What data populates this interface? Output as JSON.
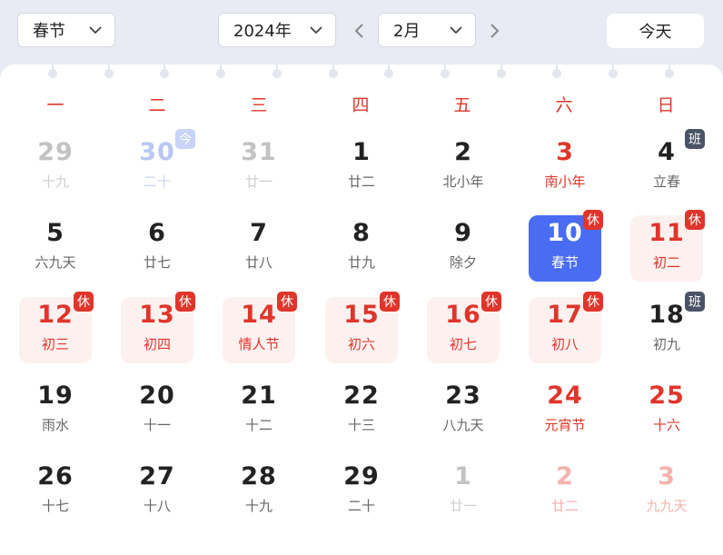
{
  "toolbar": {
    "festival_value": "春节",
    "year_value": "2024年",
    "month_value": "2月",
    "today_label": "今天"
  },
  "weekdays": [
    "一",
    "二",
    "三",
    "四",
    "五",
    "六",
    "日"
  ],
  "colors": {
    "accent_red": "#e0352b",
    "selected_blue": "#4a6cf2",
    "holiday_bg": "#fdf1f0",
    "workday_badge": "#4b5466"
  },
  "days": [
    {
      "num": "29",
      "sub": "十九",
      "type": "other"
    },
    {
      "num": "30",
      "sub": "二十",
      "type": "today-prev",
      "badge": "今"
    },
    {
      "num": "31",
      "sub": "廿一",
      "type": "other"
    },
    {
      "num": "1",
      "sub": "廿二",
      "type": "normal"
    },
    {
      "num": "2",
      "sub": "北小年",
      "type": "normal"
    },
    {
      "num": "3",
      "sub": "南小年",
      "type": "red"
    },
    {
      "num": "4",
      "sub": "立春",
      "type": "normal",
      "badge": "班"
    },
    {
      "num": "5",
      "sub": "六九天",
      "type": "normal"
    },
    {
      "num": "6",
      "sub": "廿七",
      "type": "normal"
    },
    {
      "num": "7",
      "sub": "廿八",
      "type": "normal"
    },
    {
      "num": "8",
      "sub": "廿九",
      "type": "normal"
    },
    {
      "num": "9",
      "sub": "除夕",
      "type": "normal"
    },
    {
      "num": "10",
      "sub": "春节",
      "type": "selected",
      "badge": "休"
    },
    {
      "num": "11",
      "sub": "初二",
      "type": "hol",
      "badge": "休"
    },
    {
      "num": "12",
      "sub": "初三",
      "type": "hol",
      "badge": "休"
    },
    {
      "num": "13",
      "sub": "初四",
      "type": "hol",
      "badge": "休"
    },
    {
      "num": "14",
      "sub": "情人节",
      "type": "hol",
      "badge": "休"
    },
    {
      "num": "15",
      "sub": "初六",
      "type": "hol",
      "badge": "休"
    },
    {
      "num": "16",
      "sub": "初七",
      "type": "hol",
      "badge": "休"
    },
    {
      "num": "17",
      "sub": "初八",
      "type": "hol",
      "badge": "休"
    },
    {
      "num": "18",
      "sub": "初九",
      "type": "normal",
      "badge": "班"
    },
    {
      "num": "19",
      "sub": "雨水",
      "type": "normal"
    },
    {
      "num": "20",
      "sub": "十一",
      "type": "normal"
    },
    {
      "num": "21",
      "sub": "十二",
      "type": "normal"
    },
    {
      "num": "22",
      "sub": "十三",
      "type": "normal"
    },
    {
      "num": "23",
      "sub": "八九天",
      "type": "normal"
    },
    {
      "num": "24",
      "sub": "元宵节",
      "type": "red"
    },
    {
      "num": "25",
      "sub": "十六",
      "type": "red"
    },
    {
      "num": "26",
      "sub": "十七",
      "type": "normal"
    },
    {
      "num": "27",
      "sub": "十八",
      "type": "normal"
    },
    {
      "num": "28",
      "sub": "十九",
      "type": "normal"
    },
    {
      "num": "29",
      "sub": "二十",
      "type": "normal"
    },
    {
      "num": "1",
      "sub": "廿一",
      "type": "other"
    },
    {
      "num": "2",
      "sub": "廿二",
      "type": "other red"
    },
    {
      "num": "3",
      "sub": "九九天",
      "type": "other red"
    }
  ]
}
